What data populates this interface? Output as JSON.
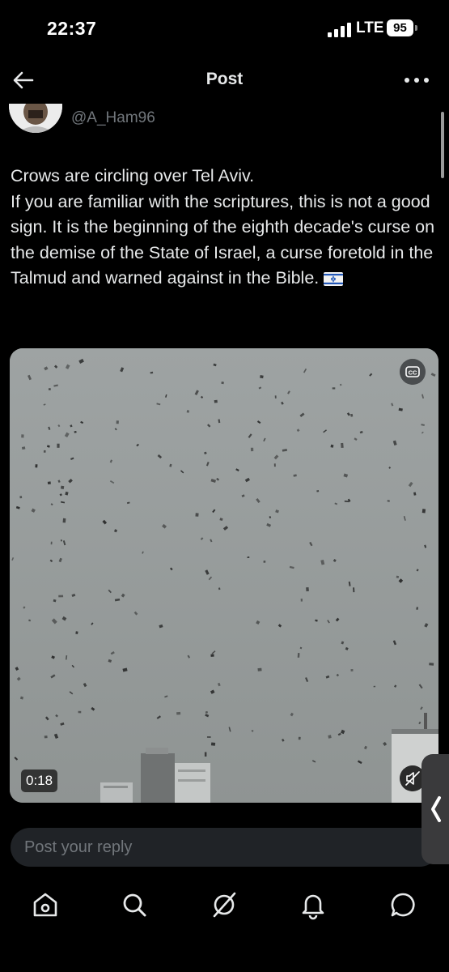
{
  "status_bar": {
    "time": "22:37",
    "network": "LTE",
    "battery": "95"
  },
  "header": {
    "title": "Post",
    "back_icon": "back-arrow-icon",
    "more_icon": "more-icon"
  },
  "author": {
    "handle": "@A_Ham96"
  },
  "post": {
    "lines": [
      "Crows are circling over Tel Aviv.",
      "If you are familiar with the scriptures, this is not a good sign. It is the beginning of the eighth decade's curse on the demise of the State of Israel, a curse foretold in the Talmud and warned against in the Bible."
    ],
    "flag_icon": "israel-flag-icon"
  },
  "video": {
    "duration": "0:18",
    "cc_icon": "closed-captions-icon",
    "mute_icon": "muted-speaker-icon"
  },
  "reply": {
    "placeholder": "Post your reply"
  },
  "nav": {
    "items": [
      "home-icon",
      "search-icon",
      "grok-icon",
      "notifications-icon",
      "messages-icon"
    ]
  }
}
